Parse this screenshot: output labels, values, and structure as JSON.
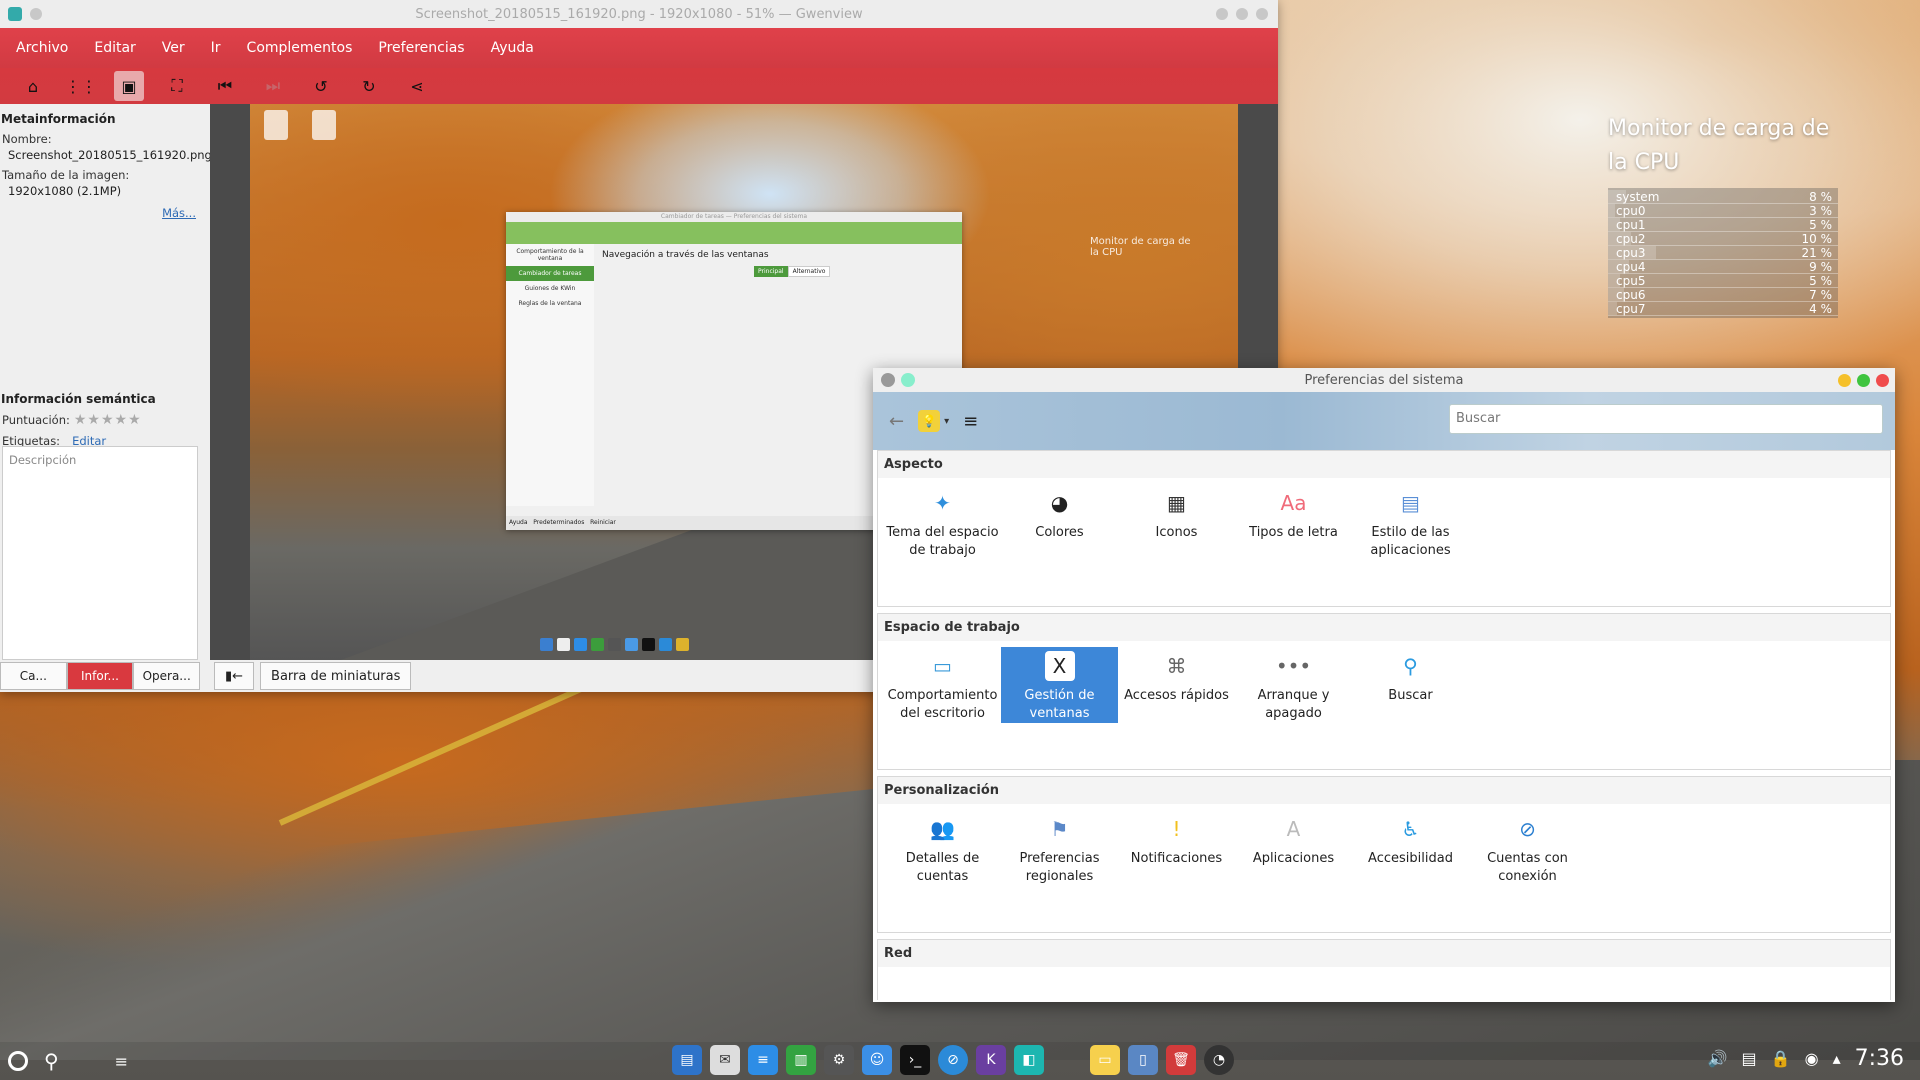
{
  "gwenview": {
    "title": "Screenshot_20180515_161920.png - 1920x1080 - 51% — Gwenview",
    "menu": [
      "Archivo",
      "Editar",
      "Ver",
      "Ir",
      "Complementos",
      "Preferencias",
      "Ayuda"
    ],
    "sidebar": {
      "meta_heading": "Metainformación",
      "name_label": "Nombre:",
      "name_value": "Screenshot_20180515_161920.png",
      "size_label": "Tamaño de la imagen:",
      "size_value": "1920x1080 (2.1MP)",
      "more_link": "Más...",
      "semantic_heading": "Información semántica",
      "rating_label": "Puntuación:",
      "rating_stars": 0,
      "tags_label": "Etiquetas:",
      "tags_edit": "Editar",
      "description_placeholder": "Descripción",
      "tabs": [
        "Ca...",
        "Infor...",
        "Opera..."
      ]
    },
    "thumbnail_bar": "Barra de miniaturas",
    "nested": {
      "window_title": "Cambiador de tareas — Preferencias del sistema",
      "sidebar": [
        "Comportamiento de la ventana",
        "Cambiador de tareas",
        "Guiones de KWin",
        "Reglas de la ventana"
      ],
      "heading": "Navegación a través de las ventanas",
      "tabs": [
        "Principal",
        "Alternativo"
      ],
      "footer": [
        "Ayuda",
        "Predeterminados",
        "Reiniciar"
      ],
      "cpu_title": "Monitor de carga de la CPU"
    }
  },
  "cpu_monitor": {
    "title": "Monitor de carga de la CPU",
    "rows": [
      {
        "name": "system",
        "value": "8 %",
        "load": 8
      },
      {
        "name": "cpu0",
        "value": "3 %",
        "load": 3
      },
      {
        "name": "cpu1",
        "value": "5 %",
        "load": 5
      },
      {
        "name": "cpu2",
        "value": "10 %",
        "load": 10
      },
      {
        "name": "cpu3",
        "value": "21 %",
        "load": 21
      },
      {
        "name": "cpu4",
        "value": "9 %",
        "load": 9
      },
      {
        "name": "cpu5",
        "value": "5 %",
        "load": 5
      },
      {
        "name": "cpu6",
        "value": "7 %",
        "load": 7
      },
      {
        "name": "cpu7",
        "value": "4 %",
        "load": 4
      }
    ]
  },
  "settings": {
    "title": "Preferencias del sistema",
    "search_placeholder": "Buscar",
    "sections": [
      {
        "heading": "Aspecto",
        "items": [
          {
            "label": "Tema del espacio de trabajo",
            "icon": "workspace-theme-icon",
            "color": "#2f8fdc"
          },
          {
            "label": "Colores",
            "icon": "colors-icon",
            "color": "#222222"
          },
          {
            "label": "Iconos",
            "icon": "icons-icon",
            "color": "#333333"
          },
          {
            "label": "Tipos de letra",
            "icon": "fonts-icon",
            "color": "#f06b7a"
          },
          {
            "label": "Estilo de las aplicaciones",
            "icon": "app-style-icon",
            "color": "#5a8fd6"
          }
        ]
      },
      {
        "heading": "Espacio de trabajo",
        "items": [
          {
            "label": "Comportamiento del escritorio",
            "icon": "desktop-behavior-icon",
            "color": "#3a9ad9"
          },
          {
            "label": "Gestión de ventanas",
            "icon": "window-management-icon",
            "color": "#ffffff",
            "selected": true
          },
          {
            "label": "Accesos rápidos",
            "icon": "shortcuts-icon",
            "color": "#666666"
          },
          {
            "label": "Arranque y apagado",
            "icon": "startup-shutdown-icon",
            "color": "#666666"
          },
          {
            "label": "Buscar",
            "icon": "search-icon",
            "color": "#2b9be0"
          }
        ]
      },
      {
        "heading": "Personalización",
        "items": [
          {
            "label": "Detalles de cuentas",
            "icon": "account-details-icon",
            "color": "#222222"
          },
          {
            "label": "Preferencias regionales",
            "icon": "regional-icon",
            "color": "#5b88c8"
          },
          {
            "label": "Notificaciones",
            "icon": "notifications-icon",
            "color": "#f2c01e"
          },
          {
            "label": "Aplicaciones",
            "icon": "applications-icon",
            "color": "#bbbbbb"
          },
          {
            "label": "Accesibilidad",
            "icon": "accessibility-icon",
            "color": "#2b9be0"
          },
          {
            "label": "Cuentas con conexión",
            "icon": "online-accounts-icon",
            "color": "#2b7fd0"
          }
        ]
      },
      {
        "heading": "Red",
        "items": []
      }
    ]
  },
  "taskbar": {
    "clock": "7:36"
  }
}
